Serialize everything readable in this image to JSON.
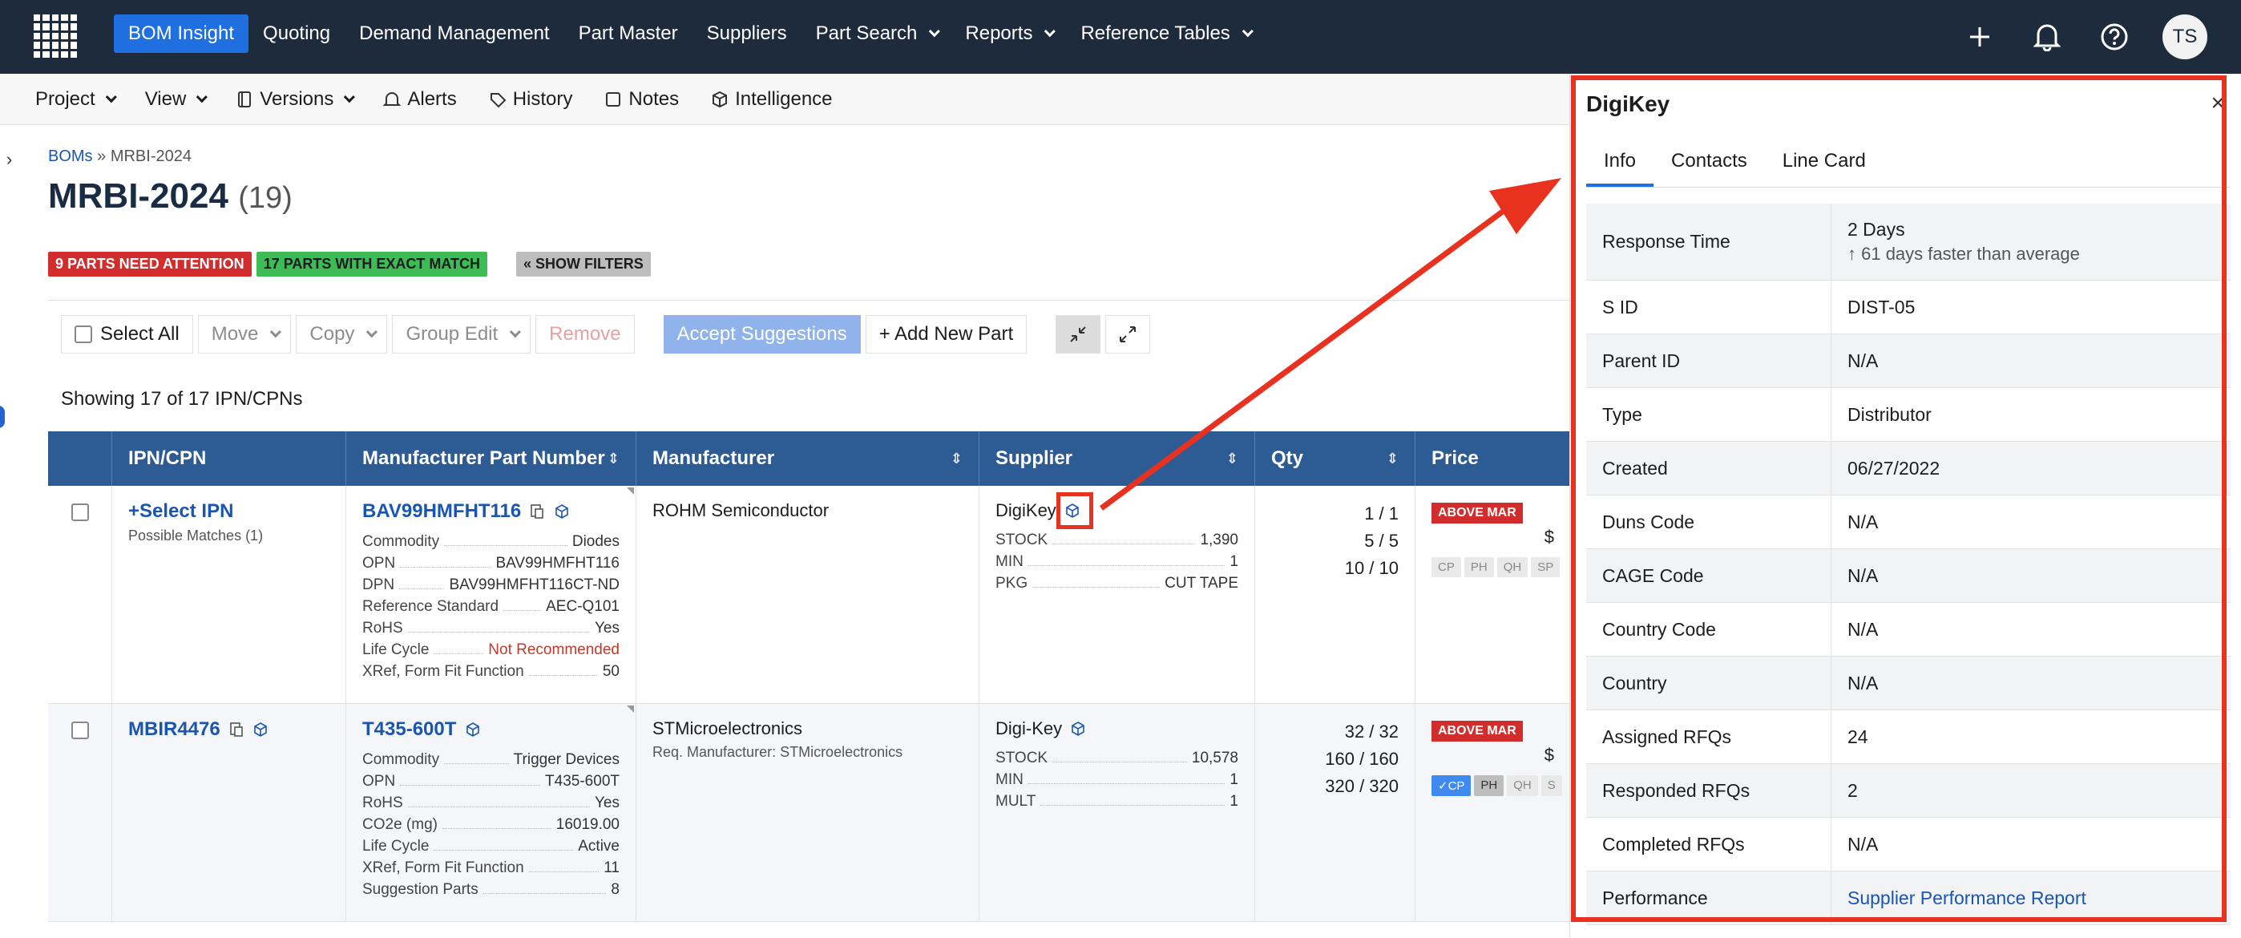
{
  "nav": {
    "items": [
      {
        "label": "BOM Insight",
        "active": true,
        "dropdown": false
      },
      {
        "label": "Quoting",
        "active": false,
        "dropdown": false
      },
      {
        "label": "Demand Management",
        "active": false,
        "dropdown": false
      },
      {
        "label": "Part Master",
        "active": false,
        "dropdown": false
      },
      {
        "label": "Suppliers",
        "active": false,
        "dropdown": false
      },
      {
        "label": "Part Search",
        "active": false,
        "dropdown": true
      },
      {
        "label": "Reports",
        "active": false,
        "dropdown": true
      },
      {
        "label": "Reference Tables",
        "active": false,
        "dropdown": true
      }
    ],
    "avatar_initials": "TS"
  },
  "subnav": {
    "project": "Project",
    "view": "View",
    "versions": "Versions",
    "alerts": "Alerts",
    "history": "History",
    "notes": "Notes",
    "intelligence": "Intelligence"
  },
  "header": {
    "breadcrumb_root": "BOMs",
    "breadcrumb_sep": "»",
    "breadcrumb_current": "MRBI-2024",
    "title": "MRBI-2024",
    "count": "(19)",
    "badge_attention": "9 PARTS NEED ATTENTION",
    "badge_match": "17 PARTS WITH EXACT MATCH",
    "badge_filters": "« SHOW FILTERS"
  },
  "toolbar": {
    "select_all": "Select All",
    "move": "Move",
    "copy": "Copy",
    "group_edit": "Group Edit",
    "remove": "Remove",
    "accept": "Accept Suggestions",
    "add_part": "+ Add New Part"
  },
  "showing": "Showing 17 of 17 IPN/CPNs",
  "table": {
    "headers": [
      "IPN/CPN",
      "Manufacturer Part Number",
      "Manufacturer",
      "Supplier",
      "Qty",
      "Price"
    ],
    "rows": [
      {
        "ipn": "+Select IPN",
        "ipn_sub": "Possible Matches (1)",
        "mpn": "BAV99HMFHT116",
        "details": [
          {
            "k": "Commodity",
            "v": "Diodes"
          },
          {
            "k": "OPN",
            "v": "BAV99HMFHT116"
          },
          {
            "k": "DPN",
            "v": "BAV99HMFHT116CT-ND"
          },
          {
            "k": "Reference Standard",
            "v": "AEC-Q101"
          },
          {
            "k": "RoHS",
            "v": "Yes"
          },
          {
            "k": "Life Cycle",
            "v": "Not Recommended"
          },
          {
            "k": "XRef, Form Fit Function",
            "v": "50"
          }
        ],
        "manufacturer": "ROHM Semiconductor",
        "manufacturer_sub": "",
        "supplier": "DigiKey",
        "supplier_details": [
          {
            "k": "STOCK",
            "v": "1,390"
          },
          {
            "k": "MIN",
            "v": "1"
          },
          {
            "k": "PKG",
            "v": "CUT TAPE"
          }
        ],
        "qty": [
          "1 / 1",
          "5 / 5",
          "10 / 10"
        ],
        "price_badge": "ABOVE MAR",
        "price_value": "$",
        "tags": [
          "CP",
          "PH",
          "QH",
          "SP"
        ]
      },
      {
        "ipn": "MBIR4476",
        "ipn_sub": "",
        "mpn": "T435-600T",
        "details": [
          {
            "k": "Commodity",
            "v": "Trigger Devices"
          },
          {
            "k": "OPN",
            "v": "T435-600T"
          },
          {
            "k": "RoHS",
            "v": "Yes"
          },
          {
            "k": "CO2e (mg)",
            "v": "16019.00"
          },
          {
            "k": "Life Cycle",
            "v": "Active"
          },
          {
            "k": "XRef, Form Fit Function",
            "v": "11"
          },
          {
            "k": "Suggestion Parts",
            "v": "8"
          }
        ],
        "manufacturer": "STMicroelectronics",
        "manufacturer_sub": "Req. Manufacturer: STMicroelectronics",
        "supplier": "Digi-Key",
        "supplier_details": [
          {
            "k": "STOCK",
            "v": "10,578"
          },
          {
            "k": "MIN",
            "v": "1"
          },
          {
            "k": "MULT",
            "v": "1"
          }
        ],
        "qty": [
          "32 / 32",
          "160 / 160",
          "320 / 320"
        ],
        "price_badge": "ABOVE MAR",
        "price_value": "$",
        "tags": [
          "✓CP",
          "PH",
          "QH",
          "S"
        ]
      }
    ]
  },
  "drawer": {
    "title": "DigiKey",
    "close": "×",
    "tabs": [
      "Info",
      "Contacts",
      "Line Card"
    ],
    "rows": [
      {
        "k": "Response Time",
        "v": "2 Days",
        "sub": "↑ 61 days faster than average"
      },
      {
        "k": "S ID",
        "v": "DIST-05"
      },
      {
        "k": "Parent ID",
        "v": "N/A"
      },
      {
        "k": "Type",
        "v": "Distributor"
      },
      {
        "k": "Created",
        "v": "06/27/2022"
      },
      {
        "k": "Duns Code",
        "v": "N/A"
      },
      {
        "k": "CAGE Code",
        "v": "N/A"
      },
      {
        "k": "Country Code",
        "v": "N/A"
      },
      {
        "k": "Country",
        "v": "N/A"
      },
      {
        "k": "Assigned RFQs",
        "v": "24"
      },
      {
        "k": "Responded RFQs",
        "v": "2"
      },
      {
        "k": "Completed RFQs",
        "v": "N/A"
      },
      {
        "k": "Performance",
        "v": "Supplier Performance Report"
      }
    ]
  },
  "colors": {
    "nav_bg": "#1e2b3c",
    "accent": "#1f6fe0",
    "table_header": "#2d5b93",
    "annotation": "#e8321f"
  }
}
